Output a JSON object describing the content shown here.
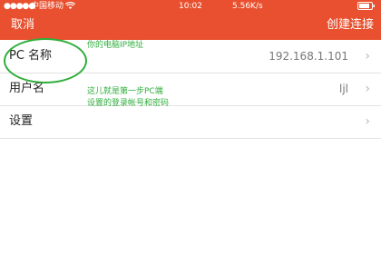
{
  "status_bar": {
    "signal": "●●●●●",
    "carrier": "中国移动",
    "wifi_icon": "wifi-icon",
    "time": "10:02",
    "speed": "5.56K/s",
    "battery": ""
  },
  "navbar": {
    "cancel_label": "取消",
    "title": "创建连接"
  },
  "rows": [
    {
      "label": "PC 名称",
      "value": "192.168.1.101"
    },
    {
      "label": "用户名",
      "value": "ljl"
    },
    {
      "label": "设置",
      "value": ""
    }
  ],
  "annotations": {
    "ip_note": "你的电脑IP地址",
    "user_note_line1": "这儿就是第一步PC端",
    "user_note_line2": "设置的登录帐号和密码"
  },
  "colors": {
    "accent": "#e8502f",
    "annotation": "#2fae3b"
  }
}
